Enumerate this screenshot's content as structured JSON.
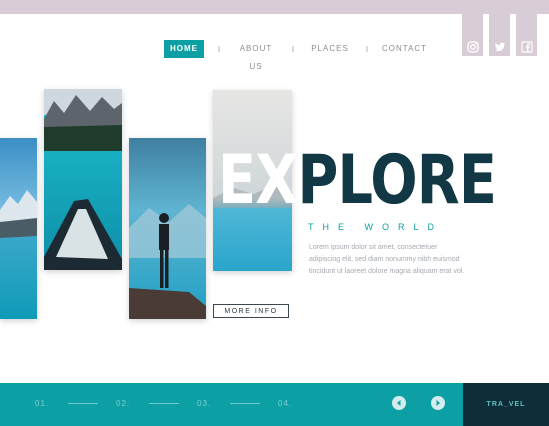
{
  "nav": {
    "items": [
      {
        "label": "HOME",
        "active": true
      },
      {
        "label": "ABOUT US",
        "active": false
      },
      {
        "label": "PLACES",
        "active": false
      },
      {
        "label": "CONTACT",
        "active": false
      }
    ],
    "separator": "I"
  },
  "social": [
    "instagram-icon",
    "twitter-icon",
    "facebook-icon"
  ],
  "hero": {
    "headline_white": "EX",
    "headline_dark": "PLORE",
    "subheadline": "THE WORLD",
    "body": "Lorem ipsum dolor sit amet, consectetuer adipiscing elit, sed diam nonummy nibh euismod tincidunt ut laoreet dolore magna aliquam erat vol.",
    "button_label": "MORE INFO"
  },
  "footer": {
    "pages": [
      "01.",
      "02.",
      "03.",
      "04."
    ],
    "prev_icon": "arrow-left-icon",
    "next_icon": "arrow-right-icon",
    "brand": "TRA_VEL"
  },
  "colors": {
    "accent": "#0c9fa4",
    "dark": "#123845",
    "top_strip": "#d8ccd6",
    "footer_dark": "#0e2d38"
  }
}
